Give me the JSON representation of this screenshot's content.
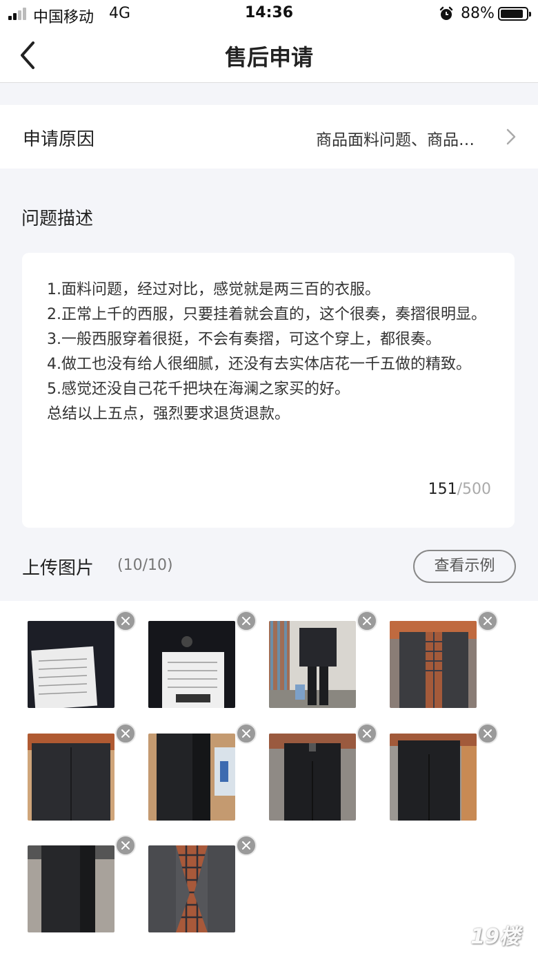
{
  "status_bar": {
    "carrier": "中国移动",
    "network": "4G",
    "time": "14:36",
    "battery": "88%",
    "battery_level": 0.88
  },
  "header": {
    "title": "售后申请",
    "back_icon": "back-arrow-icon"
  },
  "reason": {
    "label": "申请原因",
    "value": "商品面料问题、商品…"
  },
  "description": {
    "title": "问题描述",
    "lines": [
      "1.面料问题，经过对比，感觉就是两三百的衣服。",
      "2.正常上千的西服，只要挂着就会直的，这个很奏，奏摺很明显。",
      "3.一般西服穿着很挺，不会有奏摺，可这个穿上，都很奏。",
      "4.做工也没有给人很细腻，还没有去实体店花一千五做的精致。",
      "5.感觉还没自己花千把块在海澜之家买的好。",
      "总结以上五点，强烈要求退货退款。"
    ],
    "count": "151",
    "max": "/500"
  },
  "upload": {
    "title": "上传图片",
    "count": "(10/10)",
    "example_button": "查看示例"
  },
  "photos": [
    {
      "subject": "clothing label on dark fabric"
    },
    {
      "subject": "clothing label with button"
    },
    {
      "subject": "man in dark suit, front view"
    },
    {
      "subject": "man in grey suit with plaid shirt"
    },
    {
      "subject": "suit jacket back view"
    },
    {
      "subject": "suit jacket side view"
    },
    {
      "subject": "trousers front view"
    },
    {
      "subject": "trousers front view wide"
    },
    {
      "subject": "trousers side view"
    },
    {
      "subject": "grey jacket with plaid shirt close-up"
    }
  ],
  "watermark": "19楼"
}
